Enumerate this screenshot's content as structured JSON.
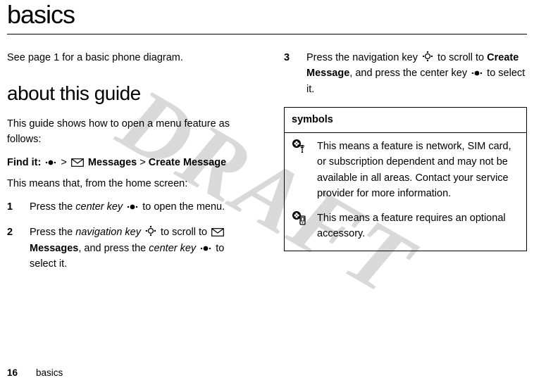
{
  "watermark": "DRAFT",
  "title": "basics",
  "intro": "See page 1 for a basic phone diagram.",
  "subtitle": "about this guide",
  "guide_intro": "This guide shows how to open a menu feature as follows:",
  "findit_label": "Find it:",
  "findit_messages": "Messages",
  "findit_create": "Create Message",
  "gt": ">",
  "means_from_home": "This means that, from the home screen:",
  "steps": {
    "s1": {
      "num": "1",
      "a": "Press the ",
      "b": "center key",
      "c": " to open the menu."
    },
    "s2": {
      "num": "2",
      "a": "Press the ",
      "b": "navigation key",
      "c": " to scroll to ",
      "d": "Messages",
      "e": ", and press the ",
      "f": "center key",
      "g": " to select it."
    },
    "s3": {
      "num": "3",
      "a": "Press the navigation key ",
      "b": " to scroll to ",
      "c": "Create Message",
      "d": ", and press the center key ",
      "e": " to select it."
    }
  },
  "symbols": {
    "header": "symbols",
    "network": "This means a feature is network, SIM card, or subscription dependent and may not be available in all areas. Contact your service provider for more information.",
    "accessory": "This means a feature requires an optional accessory."
  },
  "footer": {
    "page": "16",
    "section": "basics"
  }
}
